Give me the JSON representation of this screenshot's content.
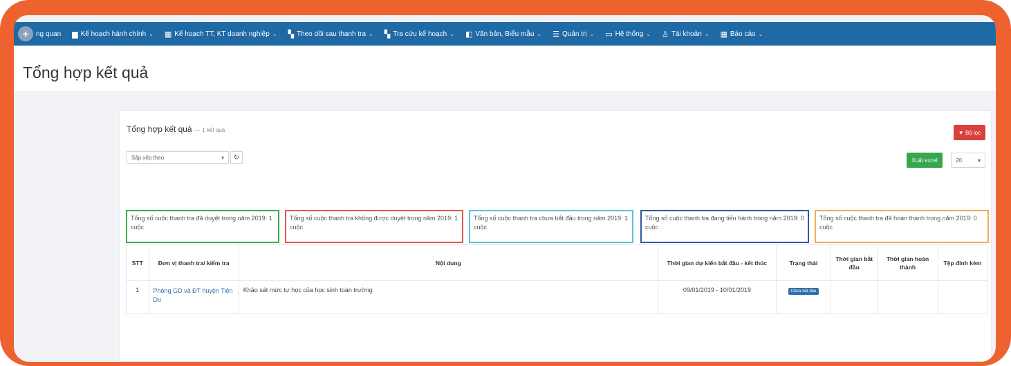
{
  "nav": {
    "items": [
      {
        "label": "ng quan",
        "icon": "plus-circle-icon"
      },
      {
        "label": "Kế hoạch hành chính",
        "icon": "briefcase-icon",
        "active": true
      },
      {
        "label": "Kế hoạch TT, KT doanh nghiệp",
        "icon": "calendar-icon"
      },
      {
        "label": "Theo dõi sau thanh tra",
        "icon": "binoculars-icon"
      },
      {
        "label": "Tra cứu kế hoạch",
        "icon": "binoculars-icon"
      },
      {
        "label": "Văn bản, Biểu mẫu",
        "icon": "book-icon"
      },
      {
        "label": "Quản trị",
        "icon": "sliders-icon"
      },
      {
        "label": "Hệ thống",
        "icon": "monitor-icon"
      },
      {
        "label": "Tài khoản",
        "icon": "user-icon"
      },
      {
        "label": "Báo cáo",
        "icon": "table-icon"
      }
    ]
  },
  "page": {
    "title": "Tổng hợp kết quả"
  },
  "panel": {
    "title": "Tổng hợp kết quả",
    "title_sep": "—",
    "count_text": "1 kết quả",
    "sort_placeholder": "Sắp xếp theo",
    "filter_label": "Bộ lọc",
    "excel_label": "Xuất excel",
    "page_size": "20"
  },
  "stats": [
    {
      "text": "Tổng số cuộc thanh tra đã duyệt trong năm 2019: 1 cuộc",
      "color": "#3cab4b"
    },
    {
      "text": "Tổng số cuộc thanh tra không được duyệt trong năm 2019: 1 cuộc",
      "color": "#e05a4e"
    },
    {
      "text": "Tổng số cuộc thanh tra chưa bắt đầu trong năm 2019: 1 cuộc",
      "color": "#5bc0de"
    },
    {
      "text": "Tổng số cuộc thanh tra đang tiến hành trong năm 2019: 0 cuộc",
      "color": "#2f5aa0"
    },
    {
      "text": "Tổng số cuộc thanh tra đã hoàn thành trong năm 2019: 0 cuộc",
      "color": "#f0ad4e"
    }
  ],
  "table": {
    "headers": {
      "stt": "STT",
      "unit": "Đơn vị thanh tra/ kiểm tra",
      "content": "Nội dung",
      "planned": "Thời gian dự kiến bắt đầu - kết thúc",
      "status": "Trạng thái",
      "start": "Thời gian bắt đầu",
      "finish": "Thời gian hoàn thành",
      "attach": "Tệp đính kèm"
    },
    "rows": [
      {
        "stt": "1",
        "unit": "Phòng GD và ĐT huyện Tiên Du",
        "content": "Khảo sát mức tự học của học sinh toàn trường",
        "planned": "09/01/2019 - 10/01/2019",
        "status": "Chưa bắt đầu",
        "start": "",
        "finish": "",
        "attach": ""
      }
    ]
  }
}
